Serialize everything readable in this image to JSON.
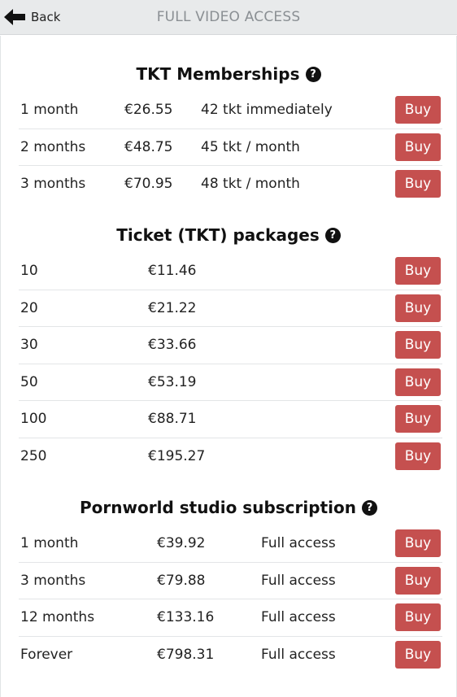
{
  "header": {
    "back_label": "Back",
    "title": "FULL VIDEO ACCESS"
  },
  "icons": {
    "back": "arrow-left-icon",
    "help": "question-circle-icon"
  },
  "colors": {
    "buy_button": "#c5504f",
    "topbar": "#e8eaeb",
    "title_text": "#8a8f93"
  },
  "memberships": {
    "title": "TKT Memberships",
    "rows": [
      {
        "duration": "1 month",
        "price": "€26.55",
        "tickets": "42 tkt immediately",
        "buy": "Buy"
      },
      {
        "duration": "2 months",
        "price": "€48.75",
        "tickets": "45 tkt / month",
        "buy": "Buy"
      },
      {
        "duration": "3 months",
        "price": "€70.95",
        "tickets": "48 tkt / month",
        "buy": "Buy"
      }
    ]
  },
  "packages": {
    "title": "Ticket (TKT) packages",
    "rows": [
      {
        "amount": "10",
        "price": "€11.46",
        "buy": "Buy"
      },
      {
        "amount": "20",
        "price": "€21.22",
        "buy": "Buy"
      },
      {
        "amount": "30",
        "price": "€33.66",
        "buy": "Buy"
      },
      {
        "amount": "50",
        "price": "€53.19",
        "buy": "Buy"
      },
      {
        "amount": "100",
        "price": "€88.71",
        "buy": "Buy"
      },
      {
        "amount": "250",
        "price": "€195.27",
        "buy": "Buy"
      }
    ]
  },
  "studio": {
    "title": "Pornworld studio subscription",
    "rows": [
      {
        "duration": "1 month",
        "price": "€39.92",
        "access": "Full access",
        "buy": "Buy"
      },
      {
        "duration": "3 months",
        "price": "€79.88",
        "access": "Full access",
        "buy": "Buy"
      },
      {
        "duration": "12 months",
        "price": "€133.16",
        "access": "Full access",
        "buy": "Buy"
      },
      {
        "duration": "Forever",
        "price": "€798.31",
        "access": "Full access",
        "buy": "Buy"
      }
    ]
  }
}
